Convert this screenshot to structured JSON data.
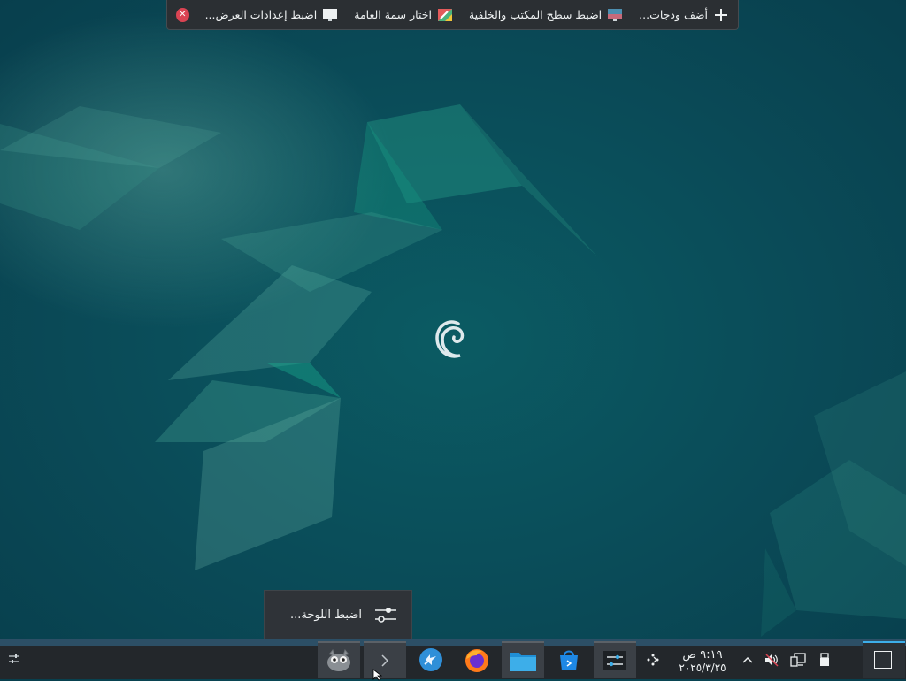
{
  "toolbar": {
    "add_widgets": "أضف ودجات...",
    "desktop_wallpaper": "اضبط سطح المكتب والخلفية",
    "global_theme": "اختار سمة العامة",
    "display_settings": "اضبط إعدادات العرض...",
    "close_icon": "close-icon"
  },
  "panel_popup": {
    "label": "اضبط اللوحة...",
    "icon": "sliders-icon"
  },
  "taskbar": {
    "apps": [
      "gimp-icon",
      "expand-arrow-icon",
      "discover-icon",
      "firefox-icon",
      "file-manager-icon",
      "software-store-icon",
      "system-settings-icon"
    ]
  },
  "clock": {
    "time": "٩:١٩ ص",
    "date": "٢٠٢٥/٣/٢٥"
  },
  "tray": {
    "icons": [
      "kdeconnect-icon",
      "expand-tray-icon",
      "volume-muted-icon",
      "network-icon",
      "usb-device-icon"
    ]
  },
  "colors": {
    "accent": "#3daee9",
    "panel": "#23272b",
    "wallpaper": "#0a4b58",
    "close": "#da4453"
  }
}
